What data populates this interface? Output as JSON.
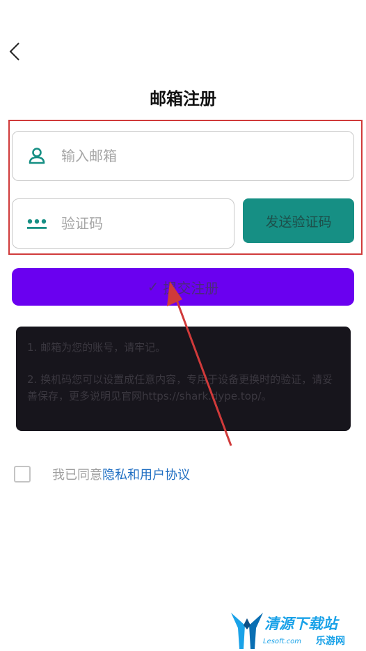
{
  "header": {
    "back_icon": "chevron-left-icon",
    "title": "邮箱注册"
  },
  "form": {
    "email": {
      "placeholder": "输入邮箱",
      "value": "",
      "icon": "user-icon"
    },
    "code": {
      "placeholder": "验证码",
      "value": "",
      "icon": "password-dots-icon"
    },
    "send_code_label": "发送验证码",
    "submit_label": "提交注册",
    "submit_check": "✓"
  },
  "notes": {
    "line1": "1. 邮箱为您的账号，请牢记。",
    "line2": "2. 换机码您可以设置成任意内容，专用于设备更换时的验证，请妥善保存，更多说明见官网https://shark.dype.top/。"
  },
  "agreement": {
    "prefix": "我已同意",
    "link": "隐私和用户协议",
    "checked": false
  },
  "watermark": {
    "brand": "清源下载站",
    "suffix": "乐游网",
    "url": "Lesoft.com"
  },
  "colors": {
    "teal": "#168f84",
    "purple": "#6a00f0",
    "link_blue": "#1f6ec2",
    "annotation_red": "#d03a3a"
  }
}
